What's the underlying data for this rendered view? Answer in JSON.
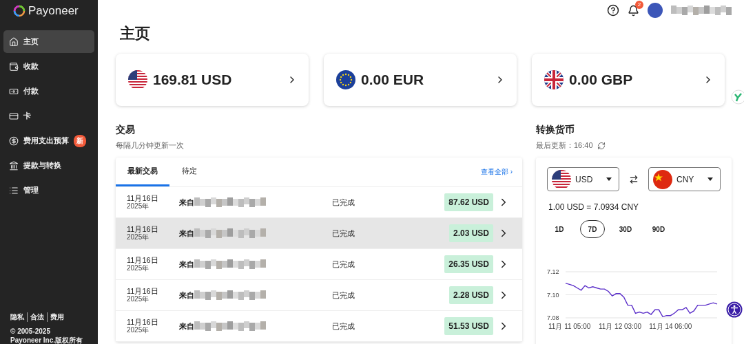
{
  "logo": {
    "text": "Payoneer"
  },
  "sidebar": {
    "items": [
      {
        "label": "主页",
        "selected": true
      },
      {
        "label": "收款",
        "selected": false
      },
      {
        "label": "付款",
        "selected": false
      },
      {
        "label": "卡",
        "selected": false
      },
      {
        "label": "费用支出预算",
        "selected": false,
        "badge": "新"
      },
      {
        "label": "提款与转换",
        "selected": false
      },
      {
        "label": "管理",
        "selected": false
      }
    ],
    "footer_links": [
      "隐私",
      "合法",
      "费用"
    ],
    "copyright": [
      "© 2005-2025",
      "Payoneer Inc.版权所有"
    ]
  },
  "header": {
    "notification_count": "2"
  },
  "page_title": "主页",
  "balances": [
    {
      "amount": "169.81 USD"
    },
    {
      "amount": "0.00 EUR"
    },
    {
      "amount": "0.00 GBP"
    }
  ],
  "transactions": {
    "title": "交易",
    "subtitle": "每隔几分钟更新一次",
    "tabs": [
      {
        "label": "最新交易",
        "selected": true
      },
      {
        "label": "待定",
        "selected": false
      }
    ],
    "view_all": "查看全部 ›",
    "rows": [
      {
        "date": "11月16日",
        "year": "2025年",
        "from": "来自",
        "status": "已完成",
        "amount": "87.62 USD",
        "highlighted": false
      },
      {
        "date": "11月16日",
        "year": "2025年",
        "from": "来自",
        "status": "已完成",
        "amount": "2.03 USD",
        "highlighted": true
      },
      {
        "date": "11月16日",
        "year": "2025年",
        "from": "来自",
        "status": "已完成",
        "amount": "26.35 USD",
        "highlighted": false
      },
      {
        "date": "11月16日",
        "year": "2025年",
        "from": "来自",
        "status": "已完成",
        "amount": "2.28 USD",
        "highlighted": false
      },
      {
        "date": "11月16日",
        "year": "2025年",
        "from": "来自",
        "status": "已完成",
        "amount": "51.53 USD",
        "highlighted": false
      }
    ]
  },
  "converter": {
    "title": "转换货币",
    "last_updated": "最后更新：16:40",
    "from": "USD",
    "to": "CNY",
    "rate": "1.00 USD = 7.0934 CNY",
    "ranges": [
      {
        "label": "1D",
        "selected": false
      },
      {
        "label": "7D",
        "selected": true
      },
      {
        "label": "30D",
        "selected": false
      },
      {
        "label": "90D",
        "selected": false
      }
    ],
    "chart_data": {
      "type": "line",
      "categories": [
        null,
        "11月 11 05:00",
        null,
        null,
        null,
        null,
        null,
        null,
        null,
        null,
        null,
        null,
        null,
        null,
        "11月 12 03:00",
        null,
        null,
        null,
        null,
        null,
        null,
        null,
        null,
        null,
        null,
        null,
        null,
        "11月 14 06:00",
        null,
        null,
        null,
        null,
        null,
        null,
        null,
        null,
        null,
        null,
        null,
        null
      ],
      "series": [
        {
          "color": "#5b2fc9",
          "values": [
            7.11,
            7.109,
            7.108,
            7.106,
            7.104,
            7.108,
            7.106,
            7.107,
            7.106,
            7.105,
            7.105,
            7.103,
            7.099,
            7.101,
            7.101,
            7.098,
            7.091,
            7.091,
            7.084,
            7.085,
            7.084,
            7.085,
            7.083,
            7.087,
            7.087,
            7.081,
            7.082,
            7.082,
            7.084,
            7.087,
            7.087,
            7.089,
            7.084,
            7.086,
            7.091,
            7.091,
            7.091,
            7.092,
            7.093,
            7.092
          ]
        }
      ],
      "ylim": [
        7.08,
        7.12
      ],
      "yticks": [
        {
          "value": 7.08,
          "label": "7.08"
        },
        {
          "value": 7.1,
          "label": "7.10"
        },
        {
          "value": 7.12,
          "label": "7.12"
        }
      ]
    }
  }
}
